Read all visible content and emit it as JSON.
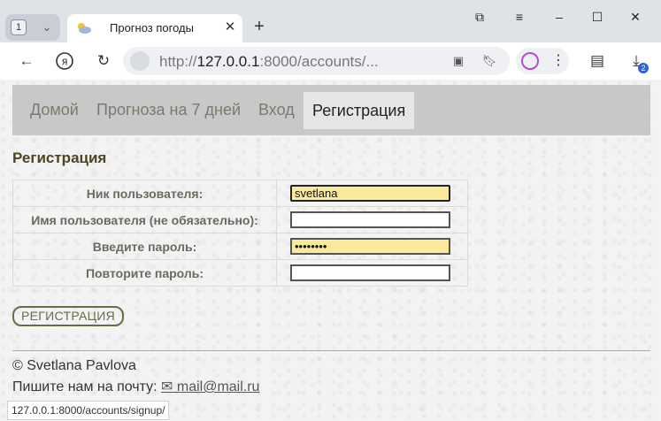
{
  "browser": {
    "tab_count": "1",
    "tab_title": "Прогноз погоды",
    "url_prefix": "http://",
    "url_host": "127.0.0.1",
    "url_rest": ":8000/accounts/...",
    "downloads_badge": "2",
    "status_url": "127.0.0.1:8000/accounts/signup/"
  },
  "nav": {
    "items": [
      {
        "label": "Домой"
      },
      {
        "label": "Прогноза на 7 дней"
      },
      {
        "label": "Вход"
      },
      {
        "label": "Регистрация",
        "active": true
      }
    ]
  },
  "form": {
    "heading": "Регистрация",
    "fields": [
      {
        "label": "Ник пользователя:",
        "value": "svetlana"
      },
      {
        "label": "Имя пользователя (не обязательно):",
        "value": ""
      },
      {
        "label": "Введите пароль:",
        "value": "••••••••"
      },
      {
        "label": "Повторите пароль:",
        "value": ""
      }
    ],
    "submit_label": "РЕГИСТРАЦИЯ"
  },
  "footer": {
    "copyright": "© Svetlana Pavlova",
    "contact_prefix": "Пишите нам на почту:",
    "email": " mail@mail.ru"
  }
}
